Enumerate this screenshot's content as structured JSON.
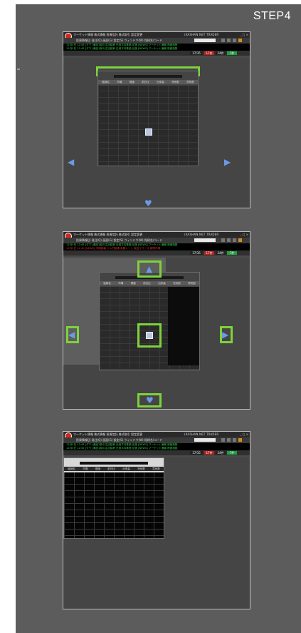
{
  "step_label": "STEP4",
  "app": {
    "name": "(KASHAN NET TRADER",
    "menu": "マーケット情報 株式情報 投資信託 株式取引 設定変更",
    "toolbar_label": "投資情報(J)  発注(Q)  画面(G)  設定(S)  ウィンドウ(W)    銘柄名/コード",
    "window_buttons": "_ □ ×",
    "ticker_green": "12月5日 12:45 [ダウ] 東証1部の注目銘柄 日経平均株価 反落 [NEWS] マーケット速報 株価指数",
    "ticker_red": "12月5日 12:40 [NEWS] 市場速報 ドル円相場 為替レート 東証マザーズ 新興市場",
    "status_values": [
      "17/35",
      "17件",
      "24件",
      "7件"
    ]
  },
  "board_columns": [
    "銘柄名",
    "市場",
    "現値",
    "前日比",
    "出来高",
    "売気配",
    "買気配"
  ],
  "colors": {
    "highlight": "#7ed23a",
    "arrow": "#6a9ae8",
    "panel": "#5c5c5c"
  },
  "icons": {
    "arrow_left": "◀",
    "arrow_right": "▶",
    "arrow_up": "▲",
    "arrow_down": "♥"
  }
}
